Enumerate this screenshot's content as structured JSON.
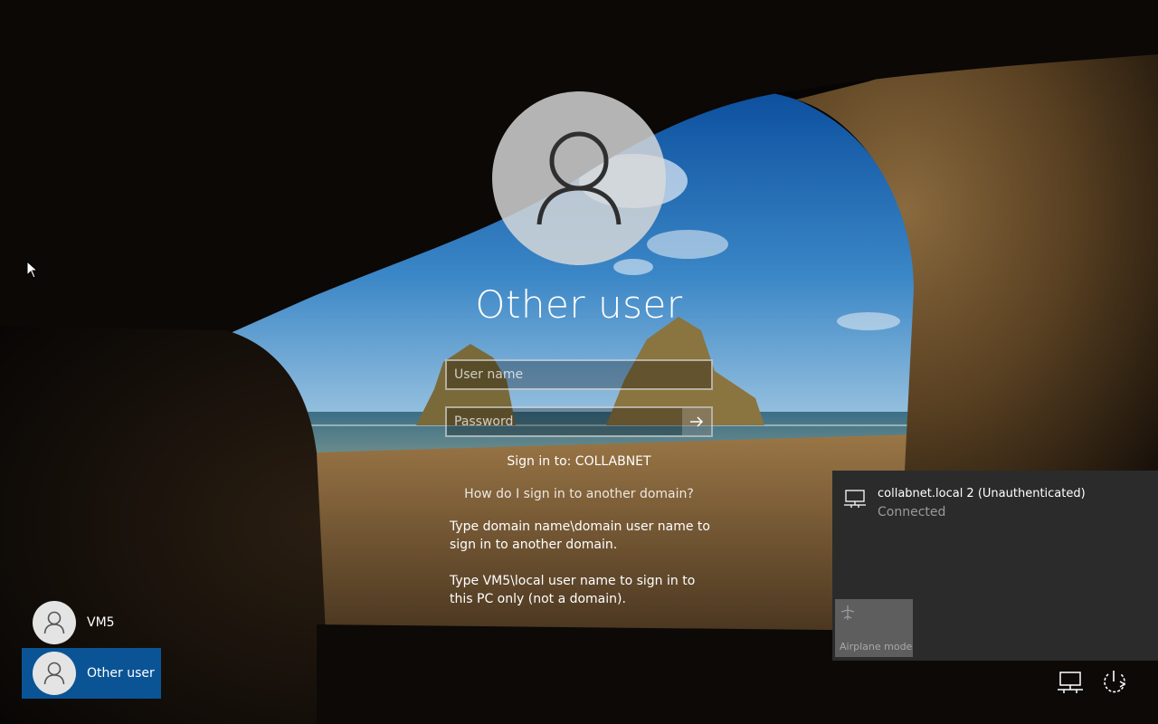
{
  "login": {
    "user_title": "Other user",
    "username_placeholder": "User name",
    "password_placeholder": "Password",
    "sign_in_to": "Sign in to: COLLABNET",
    "domain_link": "How do I sign in to another domain?",
    "help_domain": "Type domain name\\domain user name to sign in to another domain.",
    "help_local": "Type VM5\\local user name to sign in to this PC only (not a domain)."
  },
  "users": [
    {
      "label": "VM5",
      "selected": false
    },
    {
      "label": "Other user",
      "selected": true
    }
  ],
  "network": {
    "name": "collabnet.local 2 (Unauthenticated)",
    "status": "Connected",
    "airplane_label": "Airplane mode"
  },
  "icons": {
    "user": "user-icon",
    "submit": "arrow-right-icon",
    "network": "ethernet-icon",
    "airplane": "airplane-icon",
    "power": "power-icon",
    "cursor": "mouse-pointer-icon"
  },
  "colors": {
    "selected_tile": "#0a5496",
    "flyout_bg": "#2b2b2b",
    "airplane_tile": "#5e5e5e"
  }
}
